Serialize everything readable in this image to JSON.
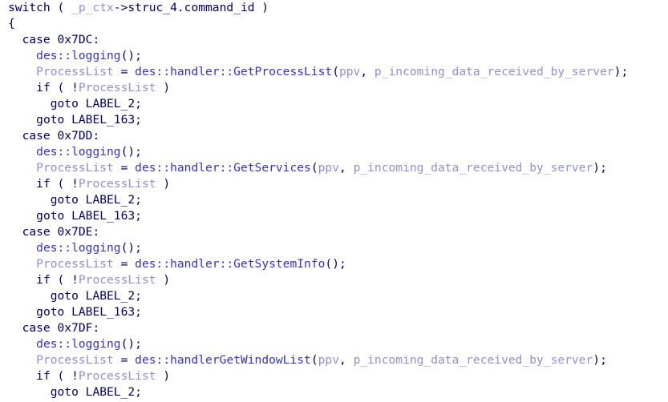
{
  "view": {
    "name": "pseudocode-view",
    "background_color": "#ffffff",
    "font_size_px": 14.6,
    "line_height_px": 20,
    "colors": {
      "keyword": "#000060",
      "punctuation": "#000060",
      "number": "#000060",
      "function": "#3333cc",
      "variable": "#8f8fd6",
      "label": "#000060"
    }
  },
  "code": {
    "language": "c++",
    "lines": [
      {
        "indent": 0,
        "tokens": [
          {
            "text": "switch ( ",
            "type": "kw"
          },
          {
            "text": "_p_ctx",
            "type": "var"
          },
          {
            "text": "->struc_4.command_id )",
            "type": "punc"
          }
        ]
      },
      {
        "indent": 0,
        "tokens": [
          {
            "text": "{",
            "type": "punc"
          }
        ]
      },
      {
        "indent": 2,
        "tokens": [
          {
            "text": "case ",
            "type": "kw"
          },
          {
            "text": "0x7DC",
            "type": "num"
          },
          {
            "text": ":",
            "type": "punc"
          }
        ]
      },
      {
        "indent": 4,
        "tokens": [
          {
            "text": "des::logging",
            "type": "fn"
          },
          {
            "text": "();",
            "type": "punc"
          }
        ]
      },
      {
        "indent": 4,
        "tokens": [
          {
            "text": "ProcessList",
            "type": "var"
          },
          {
            "text": " = ",
            "type": "punc"
          },
          {
            "text": "des::handler::GetProcessList",
            "type": "fn"
          },
          {
            "text": "(",
            "type": "punc"
          },
          {
            "text": "ppv",
            "type": "var"
          },
          {
            "text": ", ",
            "type": "punc"
          },
          {
            "text": "p_incoming_data_received_by_server",
            "type": "var"
          },
          {
            "text": ");",
            "type": "punc"
          }
        ]
      },
      {
        "indent": 4,
        "tokens": [
          {
            "text": "if ( !",
            "type": "kw"
          },
          {
            "text": "ProcessList",
            "type": "var"
          },
          {
            "text": " )",
            "type": "punc"
          }
        ]
      },
      {
        "indent": 6,
        "tokens": [
          {
            "text": "goto ",
            "type": "kw"
          },
          {
            "text": "LABEL_2",
            "type": "lbl"
          },
          {
            "text": ";",
            "type": "punc"
          }
        ]
      },
      {
        "indent": 4,
        "tokens": [
          {
            "text": "goto ",
            "type": "kw"
          },
          {
            "text": "LABEL_163",
            "type": "lbl"
          },
          {
            "text": ";",
            "type": "punc"
          }
        ]
      },
      {
        "indent": 2,
        "tokens": [
          {
            "text": "case ",
            "type": "kw"
          },
          {
            "text": "0x7DD",
            "type": "num"
          },
          {
            "text": ":",
            "type": "punc"
          }
        ]
      },
      {
        "indent": 4,
        "tokens": [
          {
            "text": "des::logging",
            "type": "fn"
          },
          {
            "text": "();",
            "type": "punc"
          }
        ]
      },
      {
        "indent": 4,
        "tokens": [
          {
            "text": "ProcessList",
            "type": "var"
          },
          {
            "text": " = ",
            "type": "punc"
          },
          {
            "text": "des::handler::GetServices",
            "type": "fn"
          },
          {
            "text": "(",
            "type": "punc"
          },
          {
            "text": "ppv",
            "type": "var"
          },
          {
            "text": ", ",
            "type": "punc"
          },
          {
            "text": "p_incoming_data_received_by_server",
            "type": "var"
          },
          {
            "text": ");",
            "type": "punc"
          }
        ]
      },
      {
        "indent": 4,
        "tokens": [
          {
            "text": "if ( !",
            "type": "kw"
          },
          {
            "text": "ProcessList",
            "type": "var"
          },
          {
            "text": " )",
            "type": "punc"
          }
        ]
      },
      {
        "indent": 6,
        "tokens": [
          {
            "text": "goto ",
            "type": "kw"
          },
          {
            "text": "LABEL_2",
            "type": "lbl"
          },
          {
            "text": ";",
            "type": "punc"
          }
        ]
      },
      {
        "indent": 4,
        "tokens": [
          {
            "text": "goto ",
            "type": "kw"
          },
          {
            "text": "LABEL_163",
            "type": "lbl"
          },
          {
            "text": ";",
            "type": "punc"
          }
        ]
      },
      {
        "indent": 2,
        "tokens": [
          {
            "text": "case ",
            "type": "kw"
          },
          {
            "text": "0x7DE",
            "type": "num"
          },
          {
            "text": ":",
            "type": "punc"
          }
        ]
      },
      {
        "indent": 4,
        "tokens": [
          {
            "text": "des::logging",
            "type": "fn"
          },
          {
            "text": "();",
            "type": "punc"
          }
        ]
      },
      {
        "indent": 4,
        "tokens": [
          {
            "text": "ProcessList",
            "type": "var"
          },
          {
            "text": " = ",
            "type": "punc"
          },
          {
            "text": "des::handler::GetSystemInfo",
            "type": "fn"
          },
          {
            "text": "();",
            "type": "punc"
          }
        ]
      },
      {
        "indent": 4,
        "tokens": [
          {
            "text": "if ( !",
            "type": "kw"
          },
          {
            "text": "ProcessList",
            "type": "var"
          },
          {
            "text": " )",
            "type": "punc"
          }
        ]
      },
      {
        "indent": 6,
        "tokens": [
          {
            "text": "goto ",
            "type": "kw"
          },
          {
            "text": "LABEL_2",
            "type": "lbl"
          },
          {
            "text": ";",
            "type": "punc"
          }
        ]
      },
      {
        "indent": 4,
        "tokens": [
          {
            "text": "goto ",
            "type": "kw"
          },
          {
            "text": "LABEL_163",
            "type": "lbl"
          },
          {
            "text": ";",
            "type": "punc"
          }
        ]
      },
      {
        "indent": 2,
        "tokens": [
          {
            "text": "case ",
            "type": "kw"
          },
          {
            "text": "0x7DF",
            "type": "num"
          },
          {
            "text": ":",
            "type": "punc"
          }
        ]
      },
      {
        "indent": 4,
        "tokens": [
          {
            "text": "des::logging",
            "type": "fn"
          },
          {
            "text": "();",
            "type": "punc"
          }
        ]
      },
      {
        "indent": 4,
        "tokens": [
          {
            "text": "ProcessList",
            "type": "var"
          },
          {
            "text": " = ",
            "type": "punc"
          },
          {
            "text": "des::handlerGetWindowList",
            "type": "fn"
          },
          {
            "text": "(",
            "type": "punc"
          },
          {
            "text": "ppv",
            "type": "var"
          },
          {
            "text": ", ",
            "type": "punc"
          },
          {
            "text": "p_incoming_data_received_by_server",
            "type": "var"
          },
          {
            "text": ");",
            "type": "punc"
          }
        ]
      },
      {
        "indent": 4,
        "tokens": [
          {
            "text": "if ( !",
            "type": "kw"
          },
          {
            "text": "ProcessList",
            "type": "var"
          },
          {
            "text": " )",
            "type": "punc"
          }
        ]
      },
      {
        "indent": 6,
        "tokens": [
          {
            "text": "goto ",
            "type": "kw"
          },
          {
            "text": "LABEL_2",
            "type": "lbl"
          },
          {
            "text": ";",
            "type": "punc"
          }
        ]
      }
    ]
  }
}
